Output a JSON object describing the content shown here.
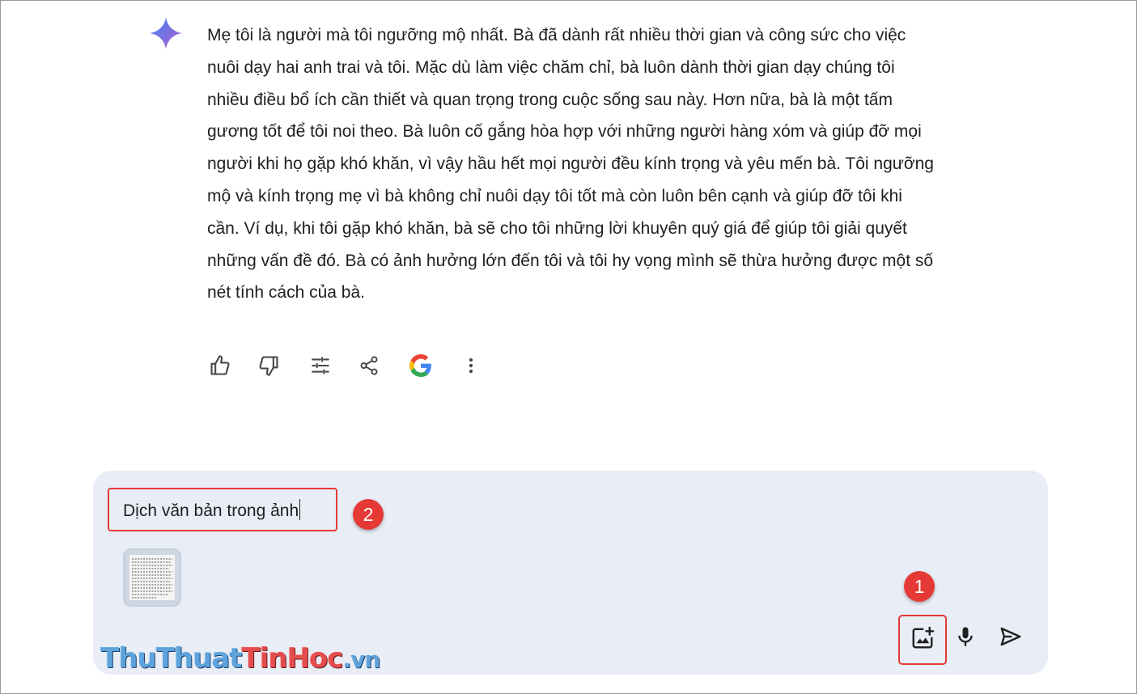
{
  "response": {
    "text": "Mẹ tôi là người mà tôi ngưỡng mộ nhất. Bà đã dành rất nhiều thời gian và công sức cho việc nuôi dạy hai anh trai và tôi. Mặc dù làm việc chăm chỉ, bà luôn dành thời gian dạy chúng tôi nhiều điều bổ ích cần thiết và quan trọng trong cuộc sống sau này. Hơn nữa, bà là một tấm gương tốt để tôi noi theo. Bà luôn cố gắng hòa hợp với những người hàng xóm và giúp đỡ mọi người khi họ gặp khó khăn, vì vậy hầu hết mọi người đều kính trọng và yêu mến bà. Tôi ngưỡng mộ và kính trọng mẹ vì bà không chỉ nuôi dạy tôi tốt mà còn luôn bên cạnh và giúp đỡ tôi khi cần. Ví dụ, khi tôi gặp khó khăn, bà sẽ cho tôi những lời khuyên quý giá để giúp tôi giải quyết những vấn đề đó. Bà có ảnh hưởng lớn đến tôi và tôi hy vọng mình sẽ thừa hưởng được một số nét tính cách của bà."
  },
  "actions": [
    {
      "icon": "thumbs-up-icon"
    },
    {
      "icon": "thumbs-down-icon"
    },
    {
      "icon": "tune-icon"
    },
    {
      "icon": "share-icon"
    },
    {
      "icon": "google-icon"
    },
    {
      "icon": "more-vert-icon"
    }
  ],
  "input": {
    "value": "Dịch văn bản trong ảnh",
    "attachment": "image-thumbnail"
  },
  "annotations": {
    "badge_1": "1",
    "badge_2": "2",
    "color": "#e53935"
  },
  "controls": [
    {
      "icon": "add-image-icon"
    },
    {
      "icon": "microphone-icon"
    },
    {
      "icon": "send-icon"
    }
  ],
  "watermark": {
    "part1": "Thu",
    "part2": "Thuat",
    "part3": "TinHoc",
    "part4": ".vn"
  },
  "colors": {
    "panel_bg": "#e8edf6",
    "highlight": "#e53935",
    "text": "#1f1f1f"
  }
}
